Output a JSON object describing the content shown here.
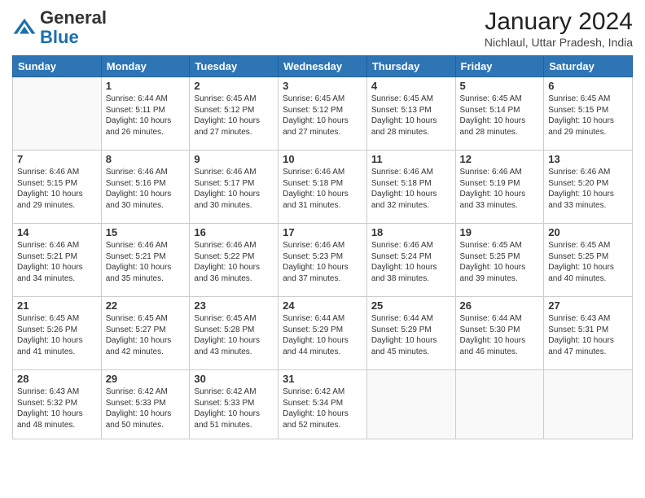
{
  "header": {
    "logo_general": "General",
    "logo_blue": "Blue",
    "month_title": "January 2024",
    "location": "Nichlaul, Uttar Pradesh, India"
  },
  "days_of_week": [
    "Sunday",
    "Monday",
    "Tuesday",
    "Wednesday",
    "Thursday",
    "Friday",
    "Saturday"
  ],
  "weeks": [
    [
      {
        "day": "",
        "info": ""
      },
      {
        "day": "1",
        "info": "Sunrise: 6:44 AM\nSunset: 5:11 PM\nDaylight: 10 hours\nand 26 minutes."
      },
      {
        "day": "2",
        "info": "Sunrise: 6:45 AM\nSunset: 5:12 PM\nDaylight: 10 hours\nand 27 minutes."
      },
      {
        "day": "3",
        "info": "Sunrise: 6:45 AM\nSunset: 5:12 PM\nDaylight: 10 hours\nand 27 minutes."
      },
      {
        "day": "4",
        "info": "Sunrise: 6:45 AM\nSunset: 5:13 PM\nDaylight: 10 hours\nand 28 minutes."
      },
      {
        "day": "5",
        "info": "Sunrise: 6:45 AM\nSunset: 5:14 PM\nDaylight: 10 hours\nand 28 minutes."
      },
      {
        "day": "6",
        "info": "Sunrise: 6:45 AM\nSunset: 5:15 PM\nDaylight: 10 hours\nand 29 minutes."
      }
    ],
    [
      {
        "day": "7",
        "info": "Sunrise: 6:46 AM\nSunset: 5:15 PM\nDaylight: 10 hours\nand 29 minutes."
      },
      {
        "day": "8",
        "info": "Sunrise: 6:46 AM\nSunset: 5:16 PM\nDaylight: 10 hours\nand 30 minutes."
      },
      {
        "day": "9",
        "info": "Sunrise: 6:46 AM\nSunset: 5:17 PM\nDaylight: 10 hours\nand 30 minutes."
      },
      {
        "day": "10",
        "info": "Sunrise: 6:46 AM\nSunset: 5:18 PM\nDaylight: 10 hours\nand 31 minutes."
      },
      {
        "day": "11",
        "info": "Sunrise: 6:46 AM\nSunset: 5:18 PM\nDaylight: 10 hours\nand 32 minutes."
      },
      {
        "day": "12",
        "info": "Sunrise: 6:46 AM\nSunset: 5:19 PM\nDaylight: 10 hours\nand 33 minutes."
      },
      {
        "day": "13",
        "info": "Sunrise: 6:46 AM\nSunset: 5:20 PM\nDaylight: 10 hours\nand 33 minutes."
      }
    ],
    [
      {
        "day": "14",
        "info": "Sunrise: 6:46 AM\nSunset: 5:21 PM\nDaylight: 10 hours\nand 34 minutes."
      },
      {
        "day": "15",
        "info": "Sunrise: 6:46 AM\nSunset: 5:21 PM\nDaylight: 10 hours\nand 35 minutes."
      },
      {
        "day": "16",
        "info": "Sunrise: 6:46 AM\nSunset: 5:22 PM\nDaylight: 10 hours\nand 36 minutes."
      },
      {
        "day": "17",
        "info": "Sunrise: 6:46 AM\nSunset: 5:23 PM\nDaylight: 10 hours\nand 37 minutes."
      },
      {
        "day": "18",
        "info": "Sunrise: 6:46 AM\nSunset: 5:24 PM\nDaylight: 10 hours\nand 38 minutes."
      },
      {
        "day": "19",
        "info": "Sunrise: 6:45 AM\nSunset: 5:25 PM\nDaylight: 10 hours\nand 39 minutes."
      },
      {
        "day": "20",
        "info": "Sunrise: 6:45 AM\nSunset: 5:25 PM\nDaylight: 10 hours\nand 40 minutes."
      }
    ],
    [
      {
        "day": "21",
        "info": "Sunrise: 6:45 AM\nSunset: 5:26 PM\nDaylight: 10 hours\nand 41 minutes."
      },
      {
        "day": "22",
        "info": "Sunrise: 6:45 AM\nSunset: 5:27 PM\nDaylight: 10 hours\nand 42 minutes."
      },
      {
        "day": "23",
        "info": "Sunrise: 6:45 AM\nSunset: 5:28 PM\nDaylight: 10 hours\nand 43 minutes."
      },
      {
        "day": "24",
        "info": "Sunrise: 6:44 AM\nSunset: 5:29 PM\nDaylight: 10 hours\nand 44 minutes."
      },
      {
        "day": "25",
        "info": "Sunrise: 6:44 AM\nSunset: 5:29 PM\nDaylight: 10 hours\nand 45 minutes."
      },
      {
        "day": "26",
        "info": "Sunrise: 6:44 AM\nSunset: 5:30 PM\nDaylight: 10 hours\nand 46 minutes."
      },
      {
        "day": "27",
        "info": "Sunrise: 6:43 AM\nSunset: 5:31 PM\nDaylight: 10 hours\nand 47 minutes."
      }
    ],
    [
      {
        "day": "28",
        "info": "Sunrise: 6:43 AM\nSunset: 5:32 PM\nDaylight: 10 hours\nand 48 minutes."
      },
      {
        "day": "29",
        "info": "Sunrise: 6:42 AM\nSunset: 5:33 PM\nDaylight: 10 hours\nand 50 minutes."
      },
      {
        "day": "30",
        "info": "Sunrise: 6:42 AM\nSunset: 5:33 PM\nDaylight: 10 hours\nand 51 minutes."
      },
      {
        "day": "31",
        "info": "Sunrise: 6:42 AM\nSunset: 5:34 PM\nDaylight: 10 hours\nand 52 minutes."
      },
      {
        "day": "",
        "info": ""
      },
      {
        "day": "",
        "info": ""
      },
      {
        "day": "",
        "info": ""
      }
    ]
  ]
}
